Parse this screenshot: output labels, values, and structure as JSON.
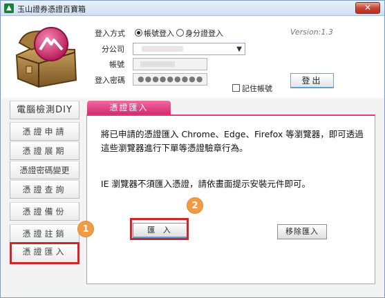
{
  "window": {
    "title": "玉山證券憑證百寶箱",
    "close_label": "✕"
  },
  "login": {
    "method_label": "登入方式",
    "method_options": [
      "帳號登入",
      "身分證登入"
    ],
    "method_selected": "帳號登入",
    "branch_label": "分公司",
    "account_label": "帳號",
    "password_label": "登入密碼",
    "password_mask": "●●●●●●●●●",
    "remember_label": "記住帳號",
    "logout_label": "登出",
    "version": "Version:1.3"
  },
  "sidebar": {
    "items": [
      {
        "label": "電腦檢測DIY"
      },
      {
        "label": "憑證申請"
      },
      {
        "label": "憑證展期"
      },
      {
        "label": "憑證密碼變更"
      },
      {
        "label": "憑證查詢"
      },
      {
        "label": "憑證備份"
      },
      {
        "label": "憑證註銷"
      },
      {
        "label": "憑證匯入"
      }
    ]
  },
  "content": {
    "tab_label": "憑證匯入",
    "info": "將已申請的憑證匯入 Chrome、Edge、Firefox 等瀏覽器，即可透過這些瀏覽器進行下單等憑證驗章行為。",
    "ie_note": "IE 瀏覽器不須匯入憑證，請依畫面提示安裝元件即可。",
    "import_label": "匯 入",
    "remove_label": "移除匯入"
  },
  "steps": {
    "one": "1",
    "two": "2"
  },
  "colors": {
    "accent": "#e03b7c",
    "highlight": "#d3242c",
    "step": "#f39a44"
  },
  "icons": {
    "app": "app-icon",
    "logo": "treasure-chest-icon"
  }
}
